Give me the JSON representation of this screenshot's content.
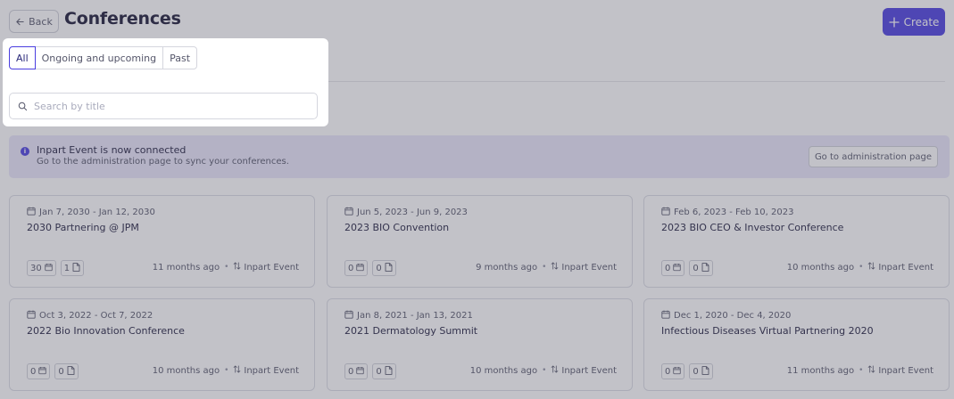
{
  "header": {
    "back_label": "Back",
    "title": "Conferences",
    "create_label": "Create"
  },
  "filters": {
    "tabs": [
      {
        "label": "All",
        "active": true
      },
      {
        "label": "Ongoing and upcoming",
        "active": false
      },
      {
        "label": "Past",
        "active": false
      }
    ],
    "search_placeholder": "Search by title",
    "search_value": ""
  },
  "banner": {
    "title": "Inpart Event is now connected",
    "subtitle": "Go to the administration page to sync your conferences.",
    "button_label": "Go to administration page"
  },
  "conferences": [
    {
      "date": "Jan 7, 2030 - Jan 12, 2030",
      "title": "2030 Partnering @ JPM",
      "events": "30",
      "docs": "1",
      "updated": "11 months ago",
      "source": "Inpart Event"
    },
    {
      "date": "Jun 5, 2023 - Jun 9, 2023",
      "title": "2023 BIO Convention",
      "events": "0",
      "docs": "0",
      "updated": "9 months ago",
      "source": "Inpart Event"
    },
    {
      "date": "Feb 6, 2023 - Feb 10, 2023",
      "title": "2023 BIO CEO & Investor Conference",
      "events": "0",
      "docs": "0",
      "updated": "10 months ago",
      "source": "Inpart Event"
    },
    {
      "date": "Oct 3, 2022 - Oct 7, 2022",
      "title": "2022 Bio Innovation Conference",
      "events": "0",
      "docs": "0",
      "updated": "10 months ago",
      "source": "Inpart Event"
    },
    {
      "date": "Jan 8, 2021 - Jan 13, 2021",
      "title": "2021 Dermatology Summit",
      "events": "0",
      "docs": "0",
      "updated": "10 months ago",
      "source": "Inpart Event"
    },
    {
      "date": "Dec 1, 2020 - Dec 4, 2020",
      "title": "Infectious Diseases Virtual Partnering 2020",
      "events": "0",
      "docs": "0",
      "updated": "11 months ago",
      "source": "Inpart Event"
    }
  ],
  "icons": {
    "back": "arrow-left-icon",
    "create": "plus-icon",
    "search": "search-icon",
    "info": "info-icon",
    "calendar": "calendar-icon",
    "document": "document-icon",
    "sync": "sync-arrows-icon"
  },
  "colors": {
    "accent": "#4a3ee0",
    "banner_bg": "#e9e7fb"
  }
}
